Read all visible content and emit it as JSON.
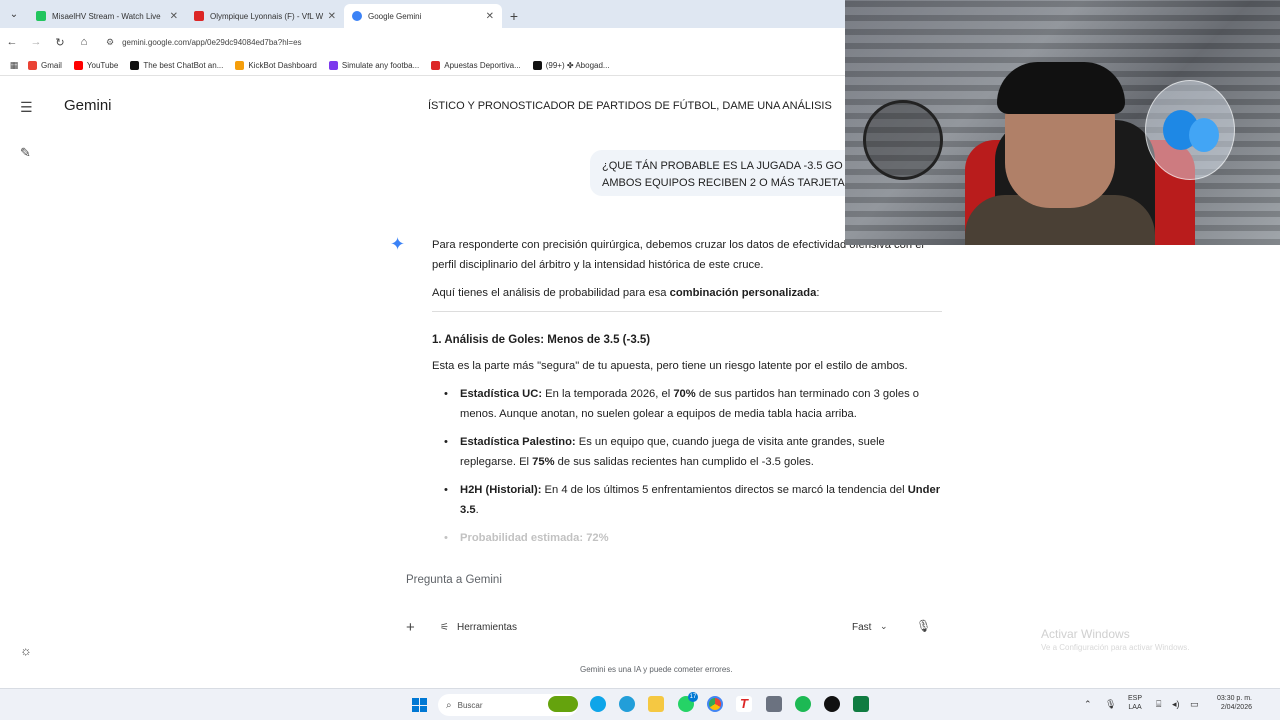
{
  "browser": {
    "tabs": [
      {
        "title": "MisaelHV Stream - Watch Live",
        "color": "#22c55e"
      },
      {
        "title": "Olympique Lyonnais (F) - VfL W",
        "color": "#dc2626"
      },
      {
        "title": "Google Gemini",
        "color": "#3b82f6"
      }
    ],
    "url": "gemini.google.com/app/0e29dc94084ed7ba?hl=es",
    "bookmarks": [
      {
        "label": "Gmail",
        "color": "#ea4335"
      },
      {
        "label": "YouTube",
        "color": "#ff0000"
      },
      {
        "label": "The best ChatBot an...",
        "color": "#111111"
      },
      {
        "label": "KickBot Dashboard",
        "color": "#f59e0b"
      },
      {
        "label": "Simulate any footba...",
        "color": "#7c3aed"
      },
      {
        "label": "Apuestas Deportiva...",
        "color": "#dc2626"
      },
      {
        "label": "(99+) ✤ Abogad...",
        "color": "#111111"
      }
    ]
  },
  "app": {
    "name": "Gemini",
    "user_prompt_1": "ÍSTICO Y PRONOSTICADOR DE PARTIDOS DE FÚTBOL, DAME UNA ANÁLISIS",
    "user_prompt_2_line1": "¿QUE TÁN PROBABLE ES LA JUGADA -3.5 GO",
    "user_prompt_2_line2": "AMBOS EQUIPOS RECIBEN 2 O MÁS TARJETA",
    "answer": {
      "intro": "Para responderte con precisión quirúrgica, debemos cruzar los datos de efectividad ofensiva con el perfil disciplinario del árbitro y la intensidad histórica de este cruce.",
      "combo_prefix": "Aquí tienes el análisis de probabilidad para esa ",
      "combo_bold": "combinación personalizada",
      "combo_suffix": ":",
      "section_title": "1. Análisis de Goles: Menos de 3.5 (-3.5)",
      "section_intro": "Esta es la parte más \"segura\" de tu apuesta, pero tiene un riesgo latente por el estilo de ambos.",
      "bullet1_label": "Estadística UC:",
      "bullet1_a": " En la temporada 2026, el ",
      "bullet1_pct": "70%",
      "bullet1_b": " de sus partidos han terminado con 3 goles o menos. Aunque anotan, no suelen golear a equipos de media tabla hacia arriba.",
      "bullet2_label": "Estadística Palestino:",
      "bullet2_a": " Es un equipo que, cuando juega de visita ante grandes, suele replegarse. El ",
      "bullet2_pct": "75%",
      "bullet2_b": " de sus salidas recientes han cumplido el -3.5 goles.",
      "bullet3_label": "H2H (Historial):",
      "bullet3_a": " En 4 de los últimos 5 enfrentamientos directos se marcó la tendencia del ",
      "bullet3_bold": "Under 3.5",
      "bullet3_b": ".",
      "bullet4": "Probabilidad estimada: 72%"
    },
    "input": {
      "placeholder": "Pregunta a Gemini",
      "tools_label": "Herramientas",
      "mode_label": "Fast"
    },
    "disclaimer": "Gemini es una IA y puede cometer errores."
  },
  "windows": {
    "watermark_title": "Activar Windows",
    "watermark_sub": "Ve a Configuración para activar Windows.",
    "search_placeholder": "Buscar",
    "notification_count": "17",
    "lang_line1": "ESP",
    "lang_line2": "LAA",
    "time": "03:30 p. m.",
    "date": "2/04/2026"
  },
  "icons": {
    "accent": "#3b82f6",
    "taskbar_accent": "#0078d4"
  }
}
